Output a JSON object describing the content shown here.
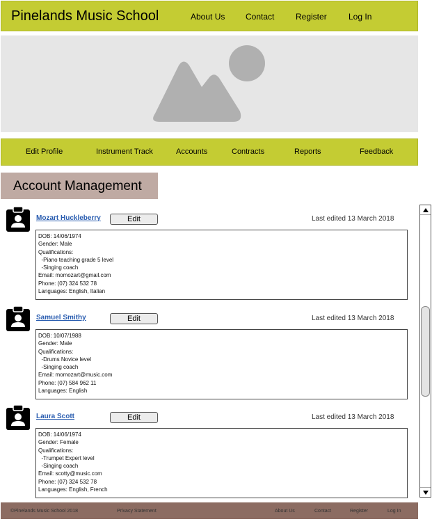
{
  "header": {
    "title": "Pinelands Music School",
    "nav": [
      "About Us",
      "Contact",
      "Register",
      "Log In"
    ]
  },
  "hero": {
    "icon": "image-placeholder-icon"
  },
  "subnav": [
    "Edit Profile",
    "Instrument Track",
    "Accounts",
    "Contracts",
    "Reports",
    "Feedback"
  ],
  "section": {
    "title": "Account Management"
  },
  "accounts": [
    {
      "name": "Mozart Huckleberry",
      "edit_label": "Edit",
      "last_edited": "Last edited 13 March 2018",
      "details": [
        "DOB: 14/06/1974",
        "Gender: Male",
        "Qualifications:",
        "  -Piano teaching grade 5 level",
        "  -Singing coach",
        "Email: momozart@gmail.com",
        "Phone: (07) 324 532 78",
        "Languages: English, Italian"
      ]
    },
    {
      "name": "Samuel Smithy",
      "edit_label": "Edit",
      "last_edited": "Last edited 13 March 2018",
      "details": [
        "DOB: 10/07/1988",
        "Gender: Male",
        "Qualifications:",
        "  -Drums Novice level",
        "  -Singing coach",
        "Email: momozart@music.com",
        "Phone: (07) 584 962 11",
        "Languages: English"
      ]
    },
    {
      "name": "Laura Scott",
      "edit_label": "Edit",
      "last_edited": "Last edited 13 March 2018",
      "details": [
        "DOB: 14/06/1974",
        "Gender: Female",
        "Qualifications:",
        "  -Trumpet Expert level",
        "  -Singing coach",
        "Email: scotty@music.com",
        "Phone: (07) 324 532 78",
        "Languages: English, French"
      ]
    }
  ],
  "footer": {
    "copyright": "©Pinelands Music School 2018",
    "privacy": "Privacy Statement",
    "links": [
      "About Us",
      "Contact",
      "Register",
      "Log In"
    ]
  },
  "colors": {
    "header_bg": "#c4cc33",
    "section_bg": "#bfaaa3",
    "footer_bg": "#8c6c62",
    "link": "#2a5db0"
  }
}
